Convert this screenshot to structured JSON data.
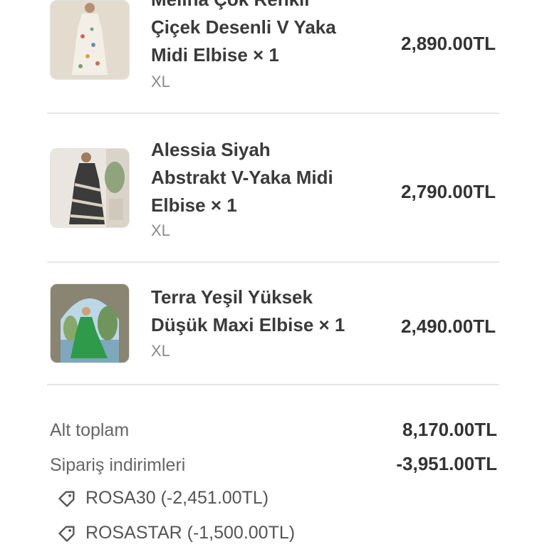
{
  "items": [
    {
      "title_line1": "Melina Çok Renkli",
      "title_line2": "Çiçek Desenli V Yaka",
      "title_line3": "Midi Elbise × 1",
      "variant": "XL",
      "price": "2,890.00TL",
      "thumb_icon": "floral-dress-photo"
    },
    {
      "title_line1": "Alessia Siyah",
      "title_line2": "Abstrakt V-Yaka Midi",
      "title_line3": "Elbise × 1",
      "variant": "XL",
      "price": "2,790.00TL",
      "thumb_icon": "abstract-dress-photo"
    },
    {
      "title_line1": "Terra Yeşil Yüksek",
      "title_line2": "Düşük Maxi Elbise × 1",
      "variant": "XL",
      "price": "2,490.00TL",
      "thumb_icon": "green-dress-photo"
    }
  ],
  "summary": {
    "subtotal_label": "Alt toplam",
    "subtotal_value": "8,170.00TL",
    "discounts_label": "Sipariş indirimleri",
    "discounts_value": "-3,951.00TL",
    "codes": [
      {
        "text": "ROSA30 (-2,451.00TL)",
        "icon": "tag-icon"
      },
      {
        "text": "ROSASTAR (-1,500.00TL)",
        "icon": "tag-icon"
      }
    ]
  },
  "colors": {
    "text": "#333333",
    "muted": "#8a8a8a",
    "divider": "#e7e7e7",
    "dress_green": "#2e9a4a"
  }
}
